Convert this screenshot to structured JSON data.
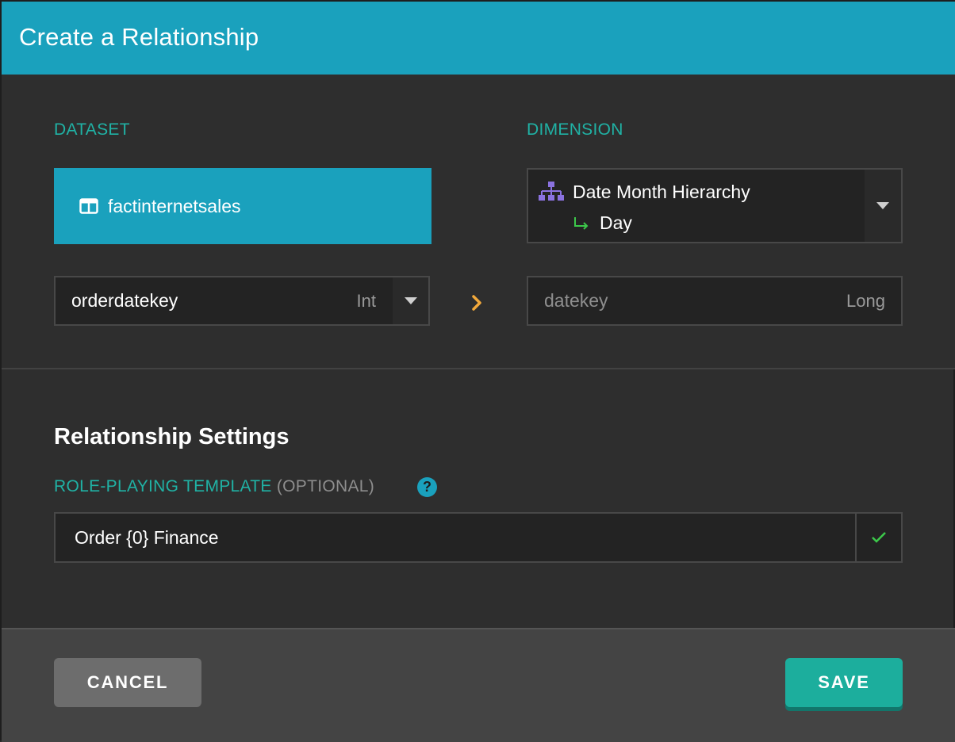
{
  "dialog": {
    "title": "Create a Relationship"
  },
  "dataset": {
    "label": "DATASET",
    "name": "factinternetsales",
    "icon": "table-icon",
    "key_field": "orderdatekey",
    "key_type": "Int"
  },
  "dimension": {
    "label": "DIMENSION",
    "hierarchy": "Date Month Hierarchy",
    "level": "Day",
    "icon": "hierarchy-icon",
    "key_field": "datekey",
    "key_type": "Long"
  },
  "settings": {
    "title": "Relationship Settings",
    "role_label": "ROLE-PLAYING TEMPLATE",
    "role_optional": "(OPTIONAL)",
    "role_value": "Order {0} Finance",
    "help_glyph": "?"
  },
  "buttons": {
    "cancel": "CANCEL",
    "save": "SAVE"
  },
  "colors": {
    "accent_blue": "#1aa1bd",
    "accent_teal": "#20b2a5",
    "save_green": "#1cae9d",
    "arrow_orange": "#f2a93b",
    "check_green": "#3cc84a"
  }
}
